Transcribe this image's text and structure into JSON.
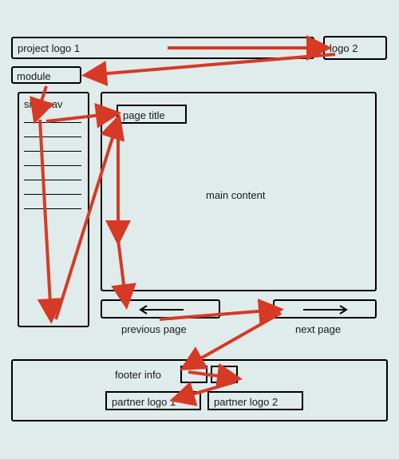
{
  "header": {
    "project_logo_1": "project logo 1",
    "logo_2": "logo 2",
    "module": "module"
  },
  "sidebar": {
    "title": "side nav"
  },
  "main": {
    "page_title": "page title",
    "content_label": "main content"
  },
  "nav": {
    "previous_label": "previous page",
    "next_label": "next page"
  },
  "footer": {
    "info_label": "footer info",
    "partner_logo_1": "partner logo 1",
    "partner_logo_2": "partner logo 2"
  },
  "flow_arrows": {
    "color": "#d63a24"
  }
}
